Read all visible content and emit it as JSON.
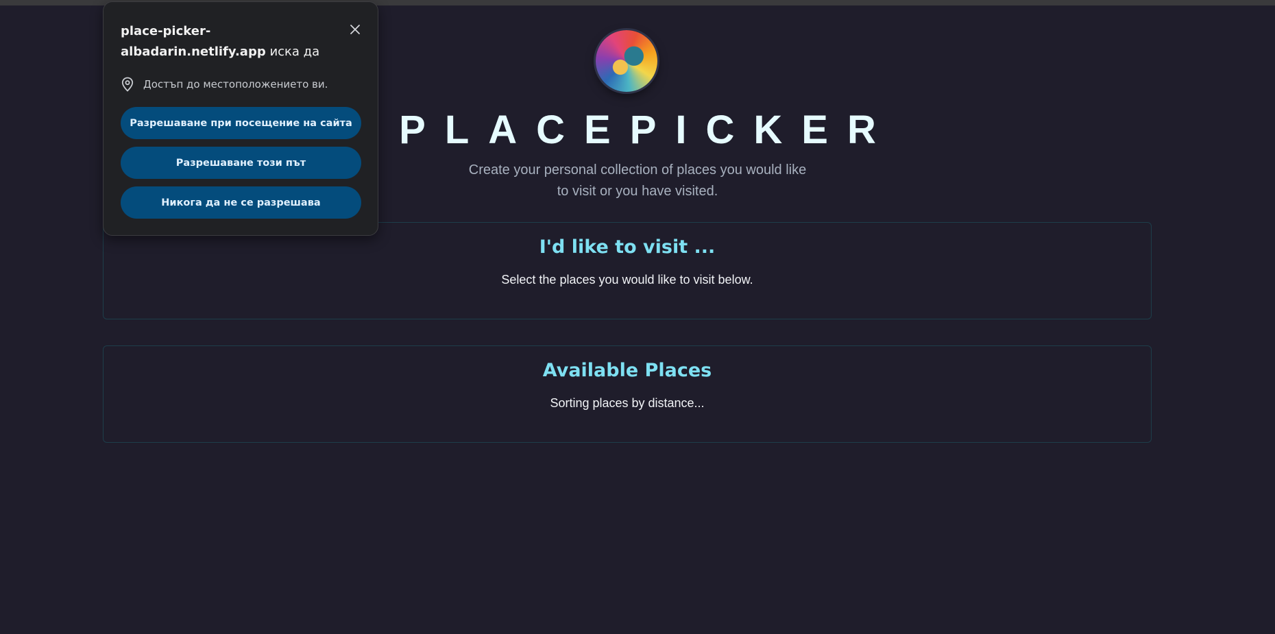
{
  "header": {
    "title": "PLACEPICKER",
    "subtitle": "Create your personal collection of places you would like to visit or you have visited."
  },
  "sections": {
    "visit": {
      "heading": "I'd like to visit ...",
      "text": "Select the places you would like to visit below."
    },
    "available": {
      "heading": "Available Places",
      "text": "Sorting places by distance..."
    }
  },
  "permission_popup": {
    "origin": "place-picker-albadarin.netlify.app",
    "request_suffix": "иска да",
    "permission_icon": "location-pin-icon",
    "permission_text": "Достъп до местоположението ви.",
    "buttons": {
      "allow_on_visit": "Разрешаване при посещение на сайта",
      "allow_once": "Разрешаване този път",
      "never_allow": "Никога да не се разрешава"
    },
    "close_icon": "close-icon"
  },
  "colors": {
    "background": "#1f1d2b",
    "accent_heading": "#7ee0f2",
    "popup_button": "#044c7c"
  }
}
